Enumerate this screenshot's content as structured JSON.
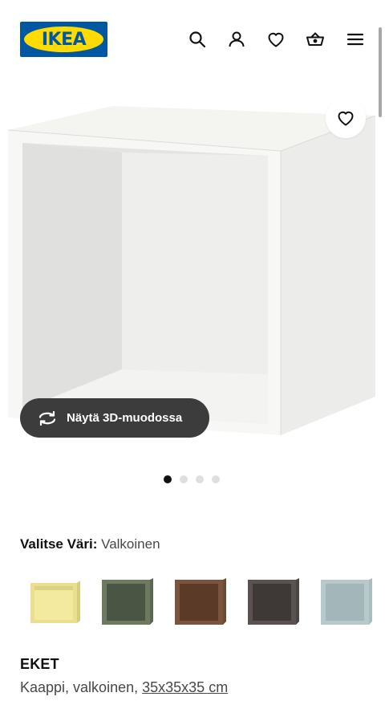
{
  "header": {
    "logo_text": "IKEA",
    "icons": [
      "search-icon",
      "user-icon",
      "heart-icon",
      "basket-icon",
      "menu-icon"
    ]
  },
  "gallery": {
    "button_3d_label": "Näytä 3D-muodossa",
    "dots_count": 4,
    "active_dot": 0
  },
  "color_selector": {
    "label": "Valitse Väri:",
    "selected": "Valkoinen",
    "swatches": [
      {
        "name": "yellow",
        "color": "#e9df8f"
      },
      {
        "name": "green",
        "color": "#6d7a5f"
      },
      {
        "name": "walnut",
        "color": "#6b4a36"
      },
      {
        "name": "dark-grey",
        "color": "#4a4442"
      },
      {
        "name": "light-blue",
        "color": "#b7c9cb"
      }
    ]
  },
  "product": {
    "name": "EKET",
    "description": "Kaappi, valkoinen,",
    "size": "35x35x35 cm"
  },
  "colors": {
    "brand_blue": "#0058a3",
    "brand_yellow": "#ffdb00",
    "button_dark": "#3c3c3c"
  }
}
